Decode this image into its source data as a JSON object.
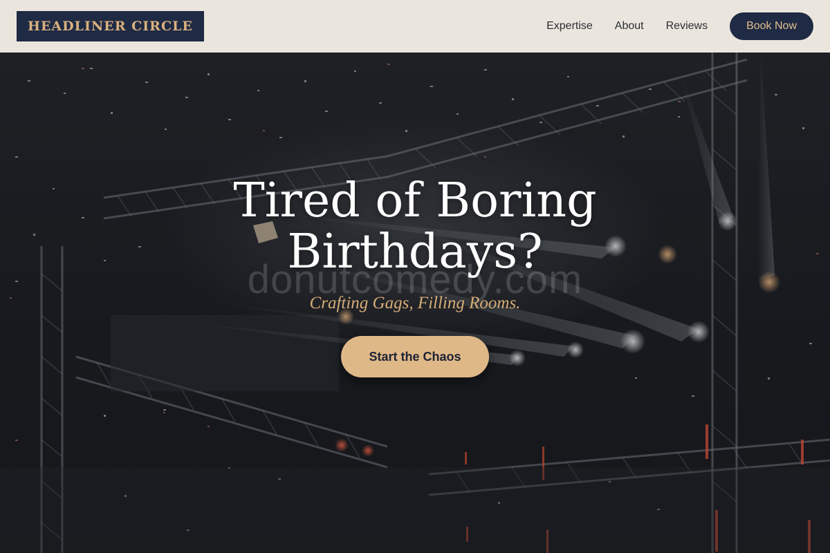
{
  "brand": {
    "name": "HEADLINER CIRCLE",
    "navy": "#1f2a44",
    "gold": "#dfb888"
  },
  "nav": {
    "links": [
      "Expertise",
      "About",
      "Reviews"
    ],
    "cta_label": "Book Now"
  },
  "hero": {
    "title": "Tired of Boring Birthdays?",
    "subtitle": "Crafting Gags, Filling Rooms.",
    "cta_label": "Start the Chaos",
    "watermark": "donutcomedy.com"
  }
}
